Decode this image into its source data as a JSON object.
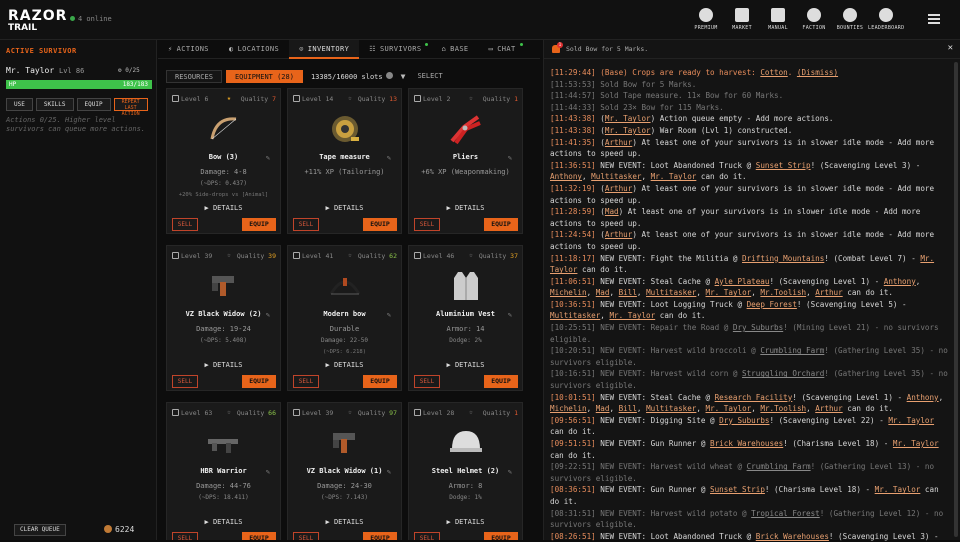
{
  "app": {
    "logo_line1": "RAZOR",
    "logo_line2": "TRAIL",
    "online": "4 online"
  },
  "top_nav": [
    {
      "label": "PREMIUM",
      "icon": "coin-icon"
    },
    {
      "label": "MARKET",
      "icon": "market-icon"
    },
    {
      "label": "MANUAL",
      "icon": "book-icon"
    },
    {
      "label": "FACTION",
      "icon": "flag-icon"
    },
    {
      "label": "BOUNTIES",
      "icon": "skull-icon"
    },
    {
      "label": "LEADERBOARD",
      "icon": "trophy-icon"
    }
  ],
  "survivor": {
    "panel_title": "ACTIVE SURVIVOR",
    "name": "Mr. Taylor",
    "level": "Lvl 86",
    "action_count": "0/25",
    "hp_label": "HP",
    "hp_value": "183/183",
    "hp_fraction": 1.0,
    "buttons": {
      "use": "USE",
      "skills": "SKILLS",
      "equip": "EQUIP",
      "repeat": "REPEAT LAST ACTION"
    },
    "hint": "Actions 0/25. Higher level survivors can queue more actions.",
    "clear_queue": "CLEAR QUEUE",
    "coins": "6224"
  },
  "main_tabs": [
    {
      "label": "ACTIONS",
      "icon": "bolt-icon"
    },
    {
      "label": "LOCATIONS",
      "icon": "globe-icon"
    },
    {
      "label": "INVENTORY",
      "icon": "backpack-icon",
      "active": true
    },
    {
      "label": "SURVIVORS",
      "icon": "people-icon",
      "dot": true
    },
    {
      "label": "BASE",
      "icon": "home-icon"
    },
    {
      "label": "CHAT",
      "icon": "chat-icon",
      "dot": true
    }
  ],
  "inventory": {
    "resources": "RESOURCES",
    "equipment": "EQUIPMENT (28)",
    "slots": "13385/16000 slots",
    "select": "SELECT",
    "details_label": "▶ DETAILS",
    "sell_label": "SELL",
    "equip_label": "EQUIP"
  },
  "items": [
    {
      "level": "Level 6",
      "quality_label": "Quality",
      "quality": "7",
      "starred": true,
      "name": "Bow (3)",
      "s1": "Damage: 4-8",
      "s2": "(~DPS: 0.437)",
      "s3": "+20% Side-drops vs [Animal]",
      "icon": "bow-icon"
    },
    {
      "level": "Level 14",
      "quality_label": "Quality",
      "quality": "13",
      "starred": false,
      "name": "Tape measure",
      "s1": "+11% XP (Tailoring)",
      "s2": "",
      "s3": "",
      "icon": "tape-measure-icon"
    },
    {
      "level": "Level 2",
      "quality_label": "Quality",
      "quality": "1",
      "starred": false,
      "name": "Pliers",
      "s1": "+6% XP (Weaponmaking)",
      "s2": "",
      "s3": "",
      "icon": "pliers-icon"
    },
    {
      "level": "Level 39",
      "quality_label": "Quality",
      "quality": "39",
      "starred": false,
      "name": "VZ Black Widow (2)",
      "s1": "Damage: 19-24",
      "s2": "(~DPS: 5.408)",
      "s3": "",
      "icon": "pistol-icon"
    },
    {
      "level": "Level 41",
      "quality_label": "Quality",
      "quality": "62",
      "starred": false,
      "name": "Modern bow",
      "s1": "Durable",
      "s2": "Damage: 22-50",
      "s3": "(~DPS: 6.218)",
      "icon": "modern-bow-icon"
    },
    {
      "level": "Level 46",
      "quality_label": "Quality",
      "quality": "37",
      "starred": false,
      "name": "Aluminium Vest",
      "s1": "Armor: 14",
      "s2": "Dodge: 2%",
      "s3": "",
      "icon": "vest-icon"
    },
    {
      "level": "Level 63",
      "quality_label": "Quality",
      "quality": "66",
      "starred": false,
      "name": "HBR Warrior",
      "s1": "Damage: 44-76",
      "s2": "(~DPS: 18.411)",
      "s3": "",
      "icon": "rifle-icon"
    },
    {
      "level": "Level 39",
      "quality_label": "Quality",
      "quality": "97",
      "starred": false,
      "name": "VZ Black Widow (1)",
      "s1": "Damage: 24-30",
      "s2": "(~DPS: 7.143)",
      "s3": "",
      "icon": "pistol-icon"
    },
    {
      "level": "Level 28",
      "quality_label": "Quality",
      "quality": "1",
      "starred": false,
      "name": "Steel Helmet (2)",
      "s1": "Armor: 8",
      "s2": "Dodge: 1%",
      "s3": "",
      "icon": "helmet-icon"
    }
  ],
  "log": {
    "header": "Sold Bow for 5 Marks.",
    "badge": "1",
    "close": "✕",
    "lines": [
      {
        "ts": "[11:29:44]",
        "dim": false,
        "parts": [
          {
            "t": "(Base) Crops are ready to harvest: ",
            "o": true
          },
          {
            "t": "Cotton",
            "u": true
          },
          {
            "t": ". ",
            "o": true
          },
          {
            "t": "(Dismiss)",
            "u": true
          }
        ]
      },
      {
        "ts": "[11:53:53]",
        "dim": true,
        "parts": [
          {
            "t": "Sold Bow for 5 Marks."
          }
        ]
      },
      {
        "ts": "[11:44:57]",
        "dim": true,
        "parts": [
          {
            "t": "Sold Tape measure. 11× Bow for 60 Marks."
          }
        ]
      },
      {
        "ts": "[11:44:33]",
        "dim": true,
        "parts": [
          {
            "t": "Sold 23× Bow for 115 Marks."
          }
        ]
      },
      {
        "ts": "[11:43:38]",
        "dim": false,
        "parts": [
          {
            "t": "("
          },
          {
            "t": "Mr. Taylor",
            "u": true
          },
          {
            "t": ") Action queue empty - Add more actions."
          }
        ]
      },
      {
        "ts": "[11:43:38]",
        "dim": false,
        "parts": [
          {
            "t": "("
          },
          {
            "t": "Mr. Taylor",
            "u": true
          },
          {
            "t": ") War Room (Lvl 1) constructed."
          }
        ]
      },
      {
        "ts": "[11:41:35]",
        "dim": false,
        "parts": [
          {
            "t": "("
          },
          {
            "t": "Arthur",
            "u": true
          },
          {
            "t": ") At least one of your survivors is in slower idle mode - Add more actions to speed up."
          }
        ]
      },
      {
        "ts": "[11:36:51]",
        "dim": false,
        "parts": [
          {
            "t": "NEW EVENT: Loot Abandoned Truck @ "
          },
          {
            "t": "Sunset Strip",
            "u": true
          },
          {
            "t": "! (Scavenging Level 3) - "
          },
          {
            "t": "Anthony",
            "u": true
          },
          {
            "t": ", "
          },
          {
            "t": "Multitasker",
            "u": true
          },
          {
            "t": ", "
          },
          {
            "t": "Mr. Taylor",
            "u": true
          },
          {
            "t": " can do it."
          }
        ]
      },
      {
        "ts": "[11:32:19]",
        "dim": false,
        "parts": [
          {
            "t": "("
          },
          {
            "t": "Arthur",
            "u": true
          },
          {
            "t": ") At least one of your survivors is in slower idle mode - Add more actions to speed up."
          }
        ]
      },
      {
        "ts": "[11:28:59]",
        "dim": false,
        "parts": [
          {
            "t": "("
          },
          {
            "t": "Mad",
            "u": true
          },
          {
            "t": ") At least one of your survivors is in slower idle mode - Add more actions to speed up."
          }
        ]
      },
      {
        "ts": "[11:24:54]",
        "dim": false,
        "parts": [
          {
            "t": "("
          },
          {
            "t": "Arthur",
            "u": true
          },
          {
            "t": ") At least one of your survivors is in slower idle mode - Add more actions to speed up."
          }
        ]
      },
      {
        "ts": "[11:18:17]",
        "dim": false,
        "parts": [
          {
            "t": "NEW EVENT: Fight the Militia @ "
          },
          {
            "t": "Drifting Mountains",
            "u": true
          },
          {
            "t": "! (Combat Level 7) - "
          },
          {
            "t": "Mr. Taylor",
            "u": true
          },
          {
            "t": " can do it."
          }
        ]
      },
      {
        "ts": "[11:06:51]",
        "dim": false,
        "parts": [
          {
            "t": "NEW EVENT: Steal Cache @ "
          },
          {
            "t": "Ayle Plateau",
            "u": true
          },
          {
            "t": "! (Scavenging Level 1) - "
          },
          {
            "t": "Anthony",
            "u": true
          },
          {
            "t": ", "
          },
          {
            "t": "Michelin",
            "u": true
          },
          {
            "t": ", "
          },
          {
            "t": "Mad",
            "u": true
          },
          {
            "t": ", "
          },
          {
            "t": "Bill",
            "u": true
          },
          {
            "t": ", "
          },
          {
            "t": "Multitasker",
            "u": true
          },
          {
            "t": ", "
          },
          {
            "t": "Mr. Taylor",
            "u": true
          },
          {
            "t": ", "
          },
          {
            "t": "Mr.Toolish",
            "u": true
          },
          {
            "t": ", "
          },
          {
            "t": "Arthur",
            "u": true
          },
          {
            "t": " can do it."
          }
        ]
      },
      {
        "ts": "[10:36:51]",
        "dim": false,
        "parts": [
          {
            "t": "NEW EVENT: Loot Logging Truck @ "
          },
          {
            "t": "Deep Forest",
            "u": true
          },
          {
            "t": "! (Scavenging Level 5) - "
          },
          {
            "t": "Multitasker",
            "u": true
          },
          {
            "t": ", "
          },
          {
            "t": "Mr. Taylor",
            "u": true
          },
          {
            "t": " can do it."
          }
        ]
      },
      {
        "ts": "[10:25:51]",
        "dim": true,
        "parts": [
          {
            "t": "NEW EVENT: Repair the Road @ "
          },
          {
            "t": "Dry Suburbs",
            "u": true
          },
          {
            "t": "! (Mining Level 21) - no survivors eligible."
          }
        ]
      },
      {
        "ts": "[10:20:51]",
        "dim": true,
        "parts": [
          {
            "t": "NEW EVENT: Harvest wild broccoli @ "
          },
          {
            "t": "Crumbling Farm",
            "u": true
          },
          {
            "t": "! (Gathering Level 35) - no survivors eligible."
          }
        ]
      },
      {
        "ts": "[10:16:51]",
        "dim": true,
        "parts": [
          {
            "t": "NEW EVENT: Harvest wild corn @ "
          },
          {
            "t": "Struggling Orchard",
            "u": true
          },
          {
            "t": "! (Gathering Level 35) - no survivors eligible."
          }
        ]
      },
      {
        "ts": "[10:01:51]",
        "dim": false,
        "parts": [
          {
            "t": "NEW EVENT: Steal Cache @ "
          },
          {
            "t": "Research Facility",
            "u": true
          },
          {
            "t": "! (Scavenging Level 1) - "
          },
          {
            "t": "Anthony",
            "u": true
          },
          {
            "t": ", "
          },
          {
            "t": "Michelin",
            "u": true
          },
          {
            "t": ", "
          },
          {
            "t": "Mad",
            "u": true
          },
          {
            "t": ", "
          },
          {
            "t": "Bill",
            "u": true
          },
          {
            "t": ", "
          },
          {
            "t": "Multitasker",
            "u": true
          },
          {
            "t": ", "
          },
          {
            "t": "Mr. Taylor",
            "u": true
          },
          {
            "t": ", "
          },
          {
            "t": "Mr.Toolish",
            "u": true
          },
          {
            "t": ", "
          },
          {
            "t": "Arthur",
            "u": true
          },
          {
            "t": " can do it."
          }
        ]
      },
      {
        "ts": "[09:56:51]",
        "dim": false,
        "parts": [
          {
            "t": "NEW EVENT: Digging Site @ "
          },
          {
            "t": "Dry Suburbs",
            "u": true
          },
          {
            "t": "! (Scavenging Level 22) - "
          },
          {
            "t": "Mr. Taylor",
            "u": true
          },
          {
            "t": " can do it."
          }
        ]
      },
      {
        "ts": "[09:51:51]",
        "dim": false,
        "parts": [
          {
            "t": "NEW EVENT: Gun Runner @ "
          },
          {
            "t": "Brick Warehouses",
            "u": true
          },
          {
            "t": "! (Charisma Level 18) - "
          },
          {
            "t": "Mr. Taylor",
            "u": true
          },
          {
            "t": " can do it."
          }
        ]
      },
      {
        "ts": "[09:22:51]",
        "dim": true,
        "parts": [
          {
            "t": "NEW EVENT: Harvest wild wheat @ "
          },
          {
            "t": "Crumbling Farm",
            "u": true
          },
          {
            "t": "! (Gathering Level 13) - no survivors eligible."
          }
        ]
      },
      {
        "ts": "[08:36:51]",
        "dim": false,
        "parts": [
          {
            "t": "NEW EVENT: Gun Runner @ "
          },
          {
            "t": "Sunset Strip",
            "u": true
          },
          {
            "t": "! (Charisma Level 18) - "
          },
          {
            "t": "Mr. Taylor",
            "u": true
          },
          {
            "t": " can do it."
          }
        ]
      },
      {
        "ts": "[08:31:51]",
        "dim": true,
        "parts": [
          {
            "t": "NEW EVENT: Harvest wild potato @ "
          },
          {
            "t": "Tropical Forest",
            "u": true
          },
          {
            "t": "! (Gathering Level 12) - no survivors eligible."
          }
        ]
      },
      {
        "ts": "[08:26:51]",
        "dim": false,
        "parts": [
          {
            "t": "NEW EVENT: Loot Abandoned Truck @ "
          },
          {
            "t": "Brick Warehouses",
            "u": true
          },
          {
            "t": "! (Scavenging Level 3) -"
          }
        ]
      }
    ]
  },
  "colors": {
    "accent": "#e8641a",
    "hp": "#3ec24a",
    "sell": "#d9583a",
    "star": "#e6a323"
  }
}
